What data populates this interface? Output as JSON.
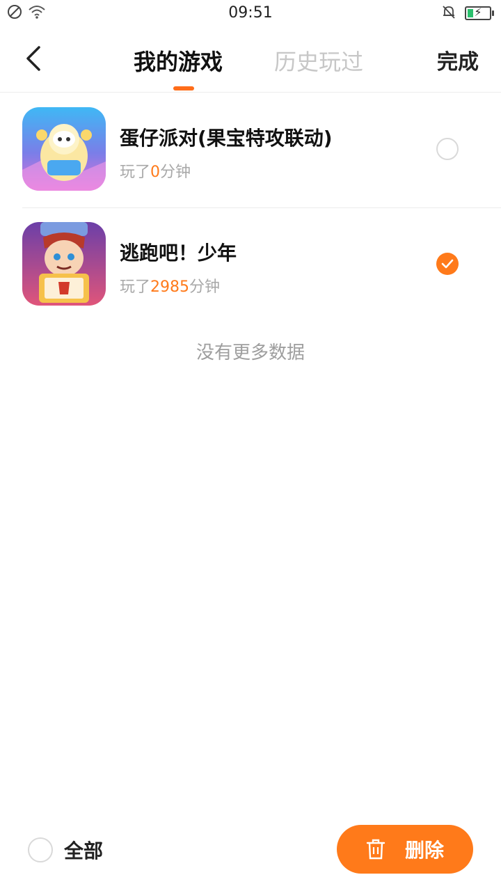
{
  "status_bar": {
    "time": "09:51"
  },
  "header": {
    "tabs": [
      {
        "label": "我的游戏",
        "active": true
      },
      {
        "label": "历史玩过",
        "active": false
      }
    ],
    "done_label": "完成"
  },
  "games": [
    {
      "title": "蛋仔派对(果宝特攻联动)",
      "played_prefix": "玩了",
      "minutes": "0",
      "played_suffix": "分钟",
      "selected": false,
      "icon": "eggy-party-icon"
    },
    {
      "title": "逃跑吧！少年",
      "played_prefix": "玩了",
      "minutes": "2985",
      "played_suffix": "分钟",
      "selected": true,
      "icon": "run-boy-game-icon"
    }
  ],
  "empty_text": "没有更多数据",
  "bottom_bar": {
    "select_all_label": "全部",
    "delete_label": "删除"
  },
  "colors": {
    "accent": "#ff7a1a",
    "indicator": "#ff6d1a",
    "muted": "#a8a8a8"
  }
}
